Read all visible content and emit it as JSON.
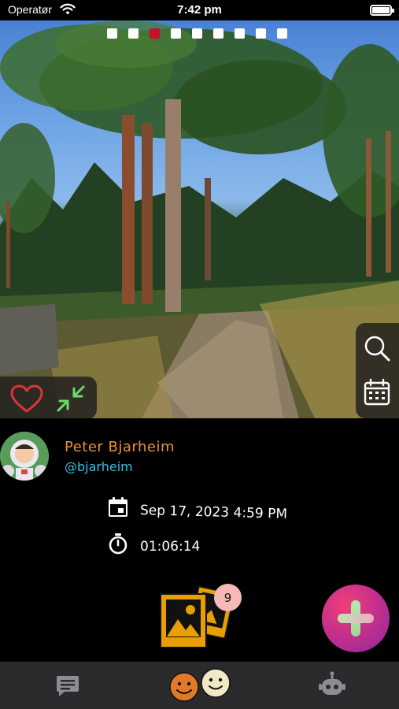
{
  "status_bar": {
    "carrier": "Operatør",
    "time": "7:42 pm"
  },
  "photo": {
    "page_dots": 9,
    "active_dot": 3
  },
  "profile": {
    "name": "Peter Bjarheim",
    "handle": "@bjarheim"
  },
  "activity": {
    "datetime": "Sep 17, 2023 4:59 PM",
    "duration": "01:06:14"
  },
  "gallery": {
    "badge_count": "9"
  },
  "icons": {
    "heart": "heart-outline-icon",
    "shrink": "shrink-arrows-icon",
    "search": "search-icon",
    "calendar": "calendar-icon",
    "event": "calendar-event-icon",
    "timer": "stopwatch-icon",
    "gallery": "photo-gallery-icon",
    "add": "plus-icon",
    "chat": "chat-icon",
    "faces": "smiley-faces-icon",
    "bot": "robot-icon"
  },
  "colors": {
    "name": "#e8913a",
    "handle": "#35c1e0",
    "active_dot": "#c8102e",
    "heart": "#e0333a",
    "shrink": "#6dd96d",
    "badge": "#f6b9b7",
    "tabbar": "#2b2b2d"
  }
}
